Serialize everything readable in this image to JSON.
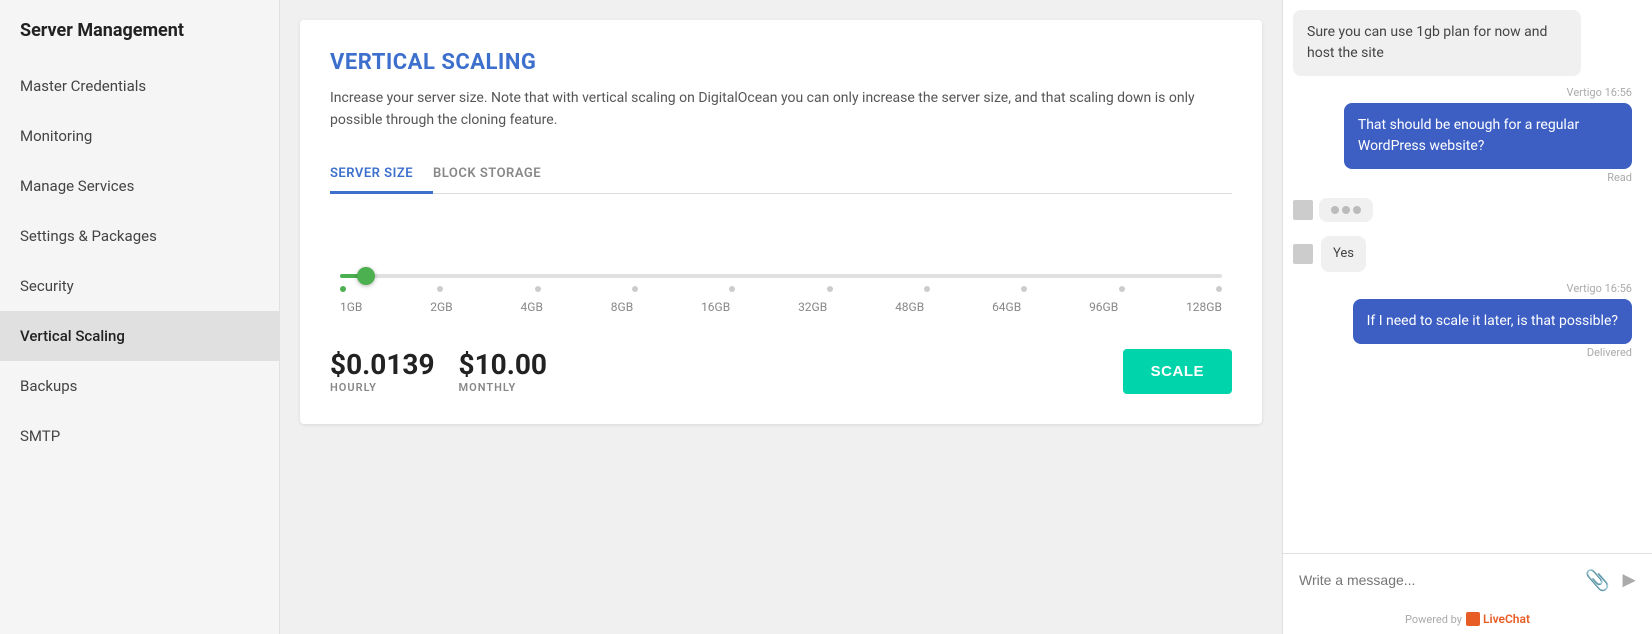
{
  "sidebar": {
    "app_title": "Server Management",
    "items": [
      {
        "id": "master-credentials",
        "label": "Master Credentials",
        "active": false
      },
      {
        "id": "monitoring",
        "label": "Monitoring",
        "active": false
      },
      {
        "id": "manage-services",
        "label": "Manage Services",
        "active": false
      },
      {
        "id": "settings-packages",
        "label": "Settings & Packages",
        "active": false
      },
      {
        "id": "security",
        "label": "Security",
        "active": false
      },
      {
        "id": "vertical-scaling",
        "label": "Vertical Scaling",
        "active": true
      },
      {
        "id": "backups",
        "label": "Backups",
        "active": false
      },
      {
        "id": "smtp",
        "label": "SMTP",
        "active": false
      }
    ]
  },
  "main": {
    "title": "VERTICAL SCALING",
    "description": "Increase your server size. Note that with vertical scaling on DigitalOcean you can only increase the server size, and that scaling down is only possible through the cloning feature.",
    "tabs": [
      {
        "id": "server-size",
        "label": "SERVER SIZE",
        "active": true
      },
      {
        "id": "block-storage",
        "label": "BLOCK STORAGE",
        "active": false
      }
    ],
    "slider": {
      "labels": [
        "1GB",
        "2GB",
        "4GB",
        "8GB",
        "16GB",
        "32GB",
        "48GB",
        "64GB",
        "96GB",
        "128GB"
      ]
    },
    "pricing": {
      "hourly_value": "$0.0139",
      "hourly_label": "HOURLY",
      "monthly_value": "$10.00",
      "monthly_label": "MONTHLY"
    },
    "scale_button": "SCALE"
  },
  "chat": {
    "messages": [
      {
        "id": 1,
        "type": "incoming",
        "text": "Sure you can use 1gb plan for now and host the site",
        "meta": "",
        "status": ""
      },
      {
        "id": 2,
        "type": "outgoing",
        "text": "That should be enough for a regular WordPress website?",
        "meta": "Vertigo 16:56",
        "status": "Read"
      },
      {
        "id": 3,
        "type": "typing",
        "text": "",
        "meta": "",
        "status": ""
      },
      {
        "id": 4,
        "type": "incoming-small",
        "text": "Yes",
        "meta": "",
        "status": ""
      },
      {
        "id": 5,
        "type": "outgoing",
        "text": "If I need to scale it later, is that possible?",
        "meta": "Vertigo 16:56",
        "status": "Delivered"
      }
    ],
    "input_placeholder": "Write a message...",
    "powered_by": "Powered by",
    "livechat_label": "LiveChat"
  }
}
